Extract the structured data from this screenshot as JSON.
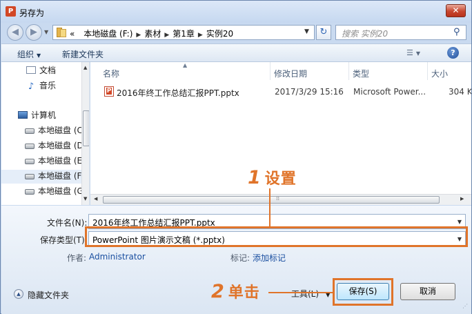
{
  "window": {
    "title": "另存为",
    "app_icon_letter": "P",
    "close_label": "✕"
  },
  "nav": {
    "back_symbol": "◀",
    "forward_symbol": "▶",
    "address": {
      "overflow": "«",
      "crumbs": [
        "本地磁盘 (F:)",
        "素材",
        "第1章",
        "实例20"
      ]
    },
    "refresh_symbol": "↻",
    "search_placeholder": "搜索 实例20",
    "search_icon": "search-icon"
  },
  "toolbar": {
    "organize_label": "组织",
    "new_folder_label": "新建文件夹",
    "help_label": "?"
  },
  "sidebar": {
    "items": [
      {
        "label": "文档",
        "icon": "document-icon"
      },
      {
        "label": "音乐",
        "icon": "music-icon"
      },
      {
        "label": "计算机",
        "icon": "computer-icon"
      },
      {
        "label": "本地磁盘 (C",
        "icon": "drive-icon"
      },
      {
        "label": "本地磁盘 (D",
        "icon": "drive-icon"
      },
      {
        "label": "本地磁盘 (E",
        "icon": "drive-icon"
      },
      {
        "label": "本地磁盘 (F",
        "icon": "drive-icon",
        "selected": true
      },
      {
        "label": "本地磁盘 (G",
        "icon": "drive-icon"
      }
    ]
  },
  "files": {
    "columns": [
      "名称",
      "修改日期",
      "类型",
      "大小"
    ],
    "rows": [
      {
        "name": "2016年终工作总结汇报PPT.pptx",
        "modified": "2017/3/29 15:16",
        "type": "Microsoft Power...",
        "size": "304 K"
      }
    ]
  },
  "form": {
    "filename_label": "文件名(N):",
    "filename_value": "2016年终工作总结汇报PPT.pptx",
    "filetype_label": "保存类型(T):",
    "filetype_value": "PowerPoint 图片演示文稿 (*.pptx)",
    "author_label": "作者:",
    "author_value": "Administrator",
    "tags_label": "标记:",
    "tags_value": "添加标记",
    "hide_folders_label": "隐藏文件夹",
    "tools_label": "工具(L)",
    "save_label": "保存(S)",
    "cancel_label": "取消"
  },
  "annotations": {
    "step1_number": "1",
    "step1_text": "设置",
    "step2_number": "2",
    "step2_text": "单击",
    "color": "#e0742a"
  }
}
